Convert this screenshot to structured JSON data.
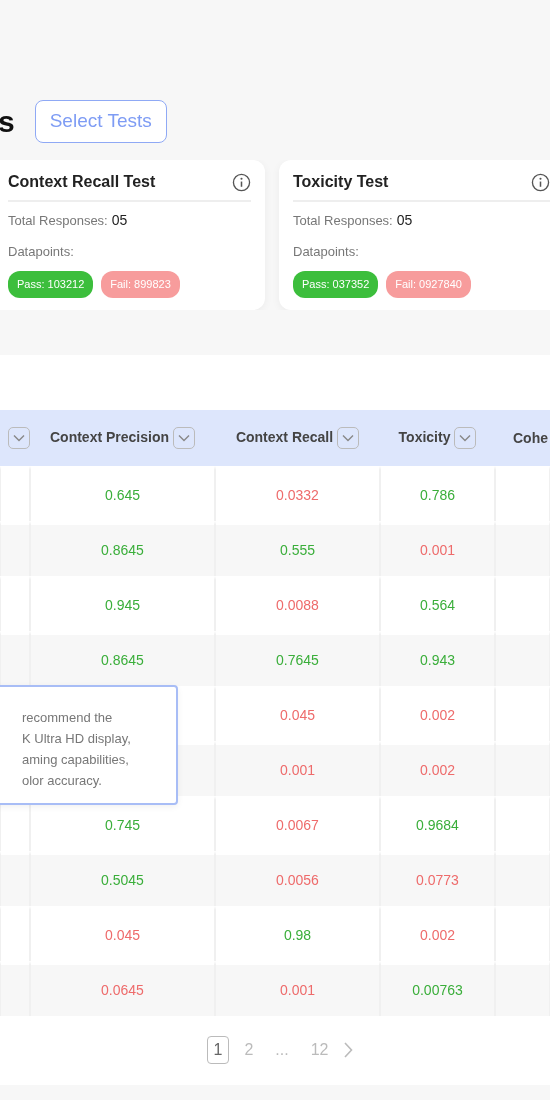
{
  "heading": "s",
  "select_button": "Select Tests",
  "cards": [
    {
      "title": "Context Recall Test",
      "responses_label": "Total Responses:",
      "responses_value": "05",
      "datapoints_label": "Datapoints:",
      "pass": "Pass: 103212",
      "fail": "Fail: 899823"
    },
    {
      "title": "Toxicity Test",
      "responses_label": "Total Responses:",
      "responses_value": "05",
      "datapoints_label": "Datapoints:",
      "pass": "Pass: 037352",
      "fail": "Fail: 0927840"
    }
  ],
  "table": {
    "columns": [
      null,
      "Context Precision",
      "Context Recall",
      "Toxicity",
      "Cohe"
    ],
    "rows": [
      {
        "cells": [
          {},
          {
            "value": "0.645",
            "passed": true
          },
          {
            "value": "0.0332",
            "passed": false
          },
          {
            "value": "0.786",
            "passed": true
          },
          {}
        ]
      },
      {
        "cells": [
          {},
          {
            "value": "0.8645",
            "passed": true
          },
          {
            "value": "0.555",
            "passed": true
          },
          {
            "value": "0.001",
            "passed": false
          },
          {}
        ]
      },
      {
        "cells": [
          {},
          {
            "value": "0.945",
            "passed": true
          },
          {
            "value": "0.0088",
            "passed": false
          },
          {
            "value": "0.564",
            "passed": true
          },
          {}
        ]
      },
      {
        "cells": [
          {},
          {
            "value": "0.8645",
            "passed": true
          },
          {
            "value": "0.7645",
            "passed": true
          },
          {
            "value": "0.943",
            "passed": true
          },
          {}
        ]
      },
      {
        "cells": [
          {},
          {},
          {
            "value": "0.045",
            "passed": false
          },
          {
            "value": "0.002",
            "passed": false
          },
          {}
        ]
      },
      {
        "cells": [
          {},
          {},
          {
            "value": "0.001",
            "passed": false
          },
          {
            "value": "0.002",
            "passed": false
          },
          {}
        ]
      },
      {
        "cells": [
          {},
          {
            "value": "0.745",
            "passed": true
          },
          {
            "value": "0.0067",
            "passed": false
          },
          {
            "value": "0.9684",
            "passed": true
          },
          {}
        ]
      },
      {
        "cells": [
          {},
          {
            "value": "0.5045",
            "passed": true
          },
          {
            "value": "0.0056",
            "passed": false
          },
          {
            "value": "0.0773",
            "passed": false
          },
          {}
        ]
      },
      {
        "cells": [
          {},
          {
            "value": "0.045",
            "passed": false
          },
          {
            "value": "0.98",
            "passed": true
          },
          {
            "value": "0.002",
            "passed": false
          },
          {}
        ]
      },
      {
        "cells": [
          {},
          {
            "value": "0.0645",
            "passed": false
          },
          {
            "value": "0.001",
            "passed": false
          },
          {
            "value": "0.00763",
            "passed": true
          },
          {}
        ]
      }
    ]
  },
  "tooltip": {
    "lines": [
      "recommend the",
      "K Ultra HD display,",
      "aming capabilities,",
      "olor accuracy."
    ]
  },
  "pagination": {
    "pages": [
      {
        "label": "1",
        "selected": true
      },
      {
        "label": "2",
        "selected": false
      },
      {
        "label": "...",
        "selected": false
      },
      {
        "label": "12",
        "selected": false
      }
    ]
  }
}
